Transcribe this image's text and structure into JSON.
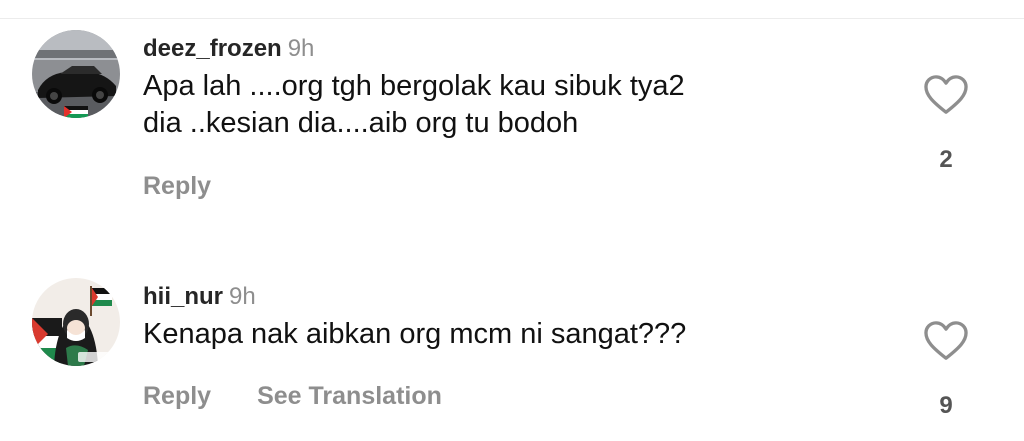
{
  "comments": [
    {
      "username": "deez_frozen",
      "time": "9h",
      "text_lines": [
        "Apa lah ....org tgh bergolak kau sibuk tya2",
        "dia ..kesian dia....aib org tu bodoh"
      ],
      "reply_label": "Reply",
      "like_count": "2",
      "avatar_icon": "car-avatar-icon"
    },
    {
      "username": "hii_nur",
      "time": "9h",
      "text_lines": [
        "Kenapa nak aibkan org mcm ni sangat???"
      ],
      "reply_label": "Reply",
      "translation_label": "See Translation",
      "like_count": "9",
      "avatar_icon": "illustrated-person-avatar-icon"
    }
  ]
}
